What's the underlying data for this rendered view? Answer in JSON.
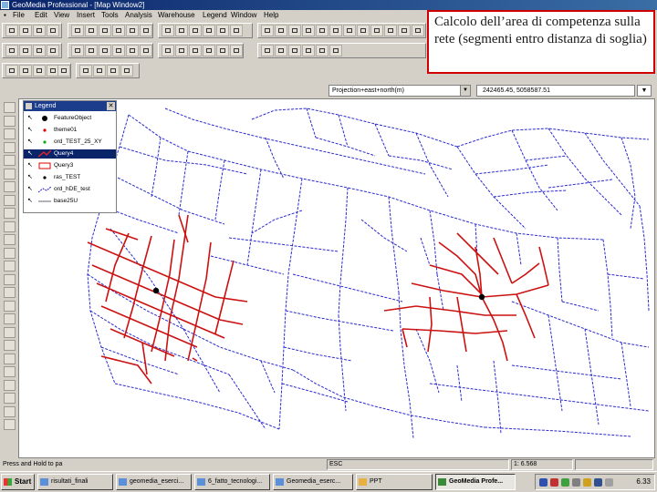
{
  "window": {
    "title": "GeoMedia Professional - [Map Window2]"
  },
  "menu": [
    "File",
    "Edit",
    "View",
    "Insert",
    "Tools",
    "Analysis",
    "Warehouse",
    "Legend",
    "Window",
    "Help"
  ],
  "callout": {
    "text": "Calcolo dell’area di competenza sulla rete (segmenti entro distanza di soglia)"
  },
  "coord_bar": {
    "projection": "Projection+east+north(m)",
    "coordinates": "242465.45, 5058587.51"
  },
  "legend": {
    "title": "Legend",
    "entries": [
      {
        "name": "FeatureObject",
        "symbol": "hexagon-point",
        "selected": false
      },
      {
        "name": "theme01",
        "symbol": "red-point",
        "selected": false
      },
      {
        "name": "ord_TEST_25_XY",
        "symbol": "green-point",
        "selected": false
      },
      {
        "name": "Query4",
        "symbol": "red-line",
        "selected": true
      },
      {
        "name": "Query3",
        "symbol": "red-box",
        "selected": false
      },
      {
        "name": "ras_TEST",
        "symbol": "black-point",
        "selected": false
      },
      {
        "name": "ord_hDE_test",
        "symbol": "blue-dash",
        "selected": false
      },
      {
        "name": "base25U",
        "symbol": "gray-line",
        "selected": false
      }
    ]
  },
  "status": {
    "prompt": "Press and Hold to pa",
    "key": "ESC",
    "scale": "1: 6.568"
  },
  "taskbar": {
    "start": "Start",
    "tasks": [
      {
        "label": "risultati_finali",
        "active": false
      },
      {
        "label": "geomedia_eserci...",
        "active": false
      },
      {
        "label": "6_fatto_tecnologi...",
        "active": false
      },
      {
        "label": "Geomedia_eserc...",
        "active": false
      },
      {
        "label": "PPT",
        "active": false
      },
      {
        "label": "GeoMedia Profe...",
        "active": true
      }
    ],
    "clock": "6.33"
  },
  "colors": {
    "network": "#2a2ad0",
    "service_area": "#cc1111",
    "callout_border": "#d00000",
    "titlebar": "#0a246a"
  }
}
